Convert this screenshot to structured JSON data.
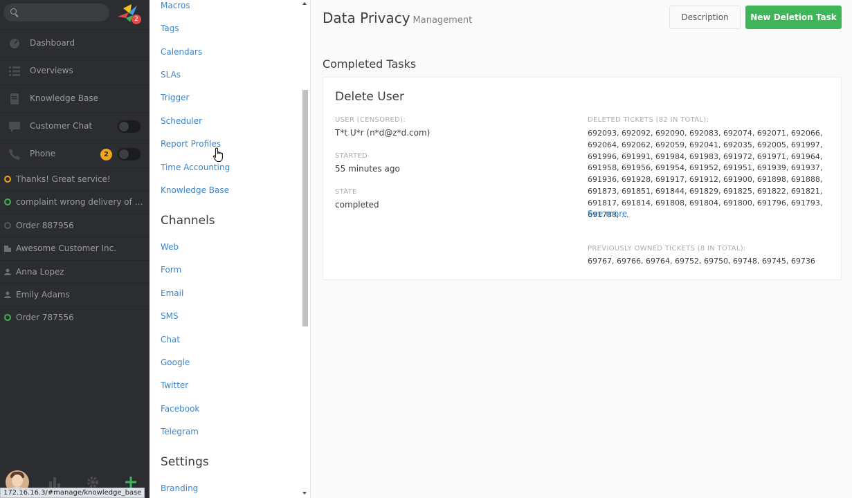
{
  "nav": {
    "notification_count": "2",
    "items": [
      {
        "label": "Dashboard",
        "icon": "dashboard-icon"
      },
      {
        "label": "Overviews",
        "icon": "list-icon"
      },
      {
        "label": "Knowledge Base",
        "icon": "book-icon"
      },
      {
        "label": "Customer Chat",
        "icon": "chat-icon"
      },
      {
        "label": "Phone",
        "icon": "phone-icon"
      }
    ],
    "phone_badge": "2",
    "tasks": [
      {
        "label": "Thanks! Great service!",
        "icon": "ticket-ring-icon",
        "color": "#f0a51a"
      },
      {
        "label": "complaint wrong delivery of order",
        "icon": "ticket-ring-icon",
        "color": "#3fb55a"
      },
      {
        "label": "Order 887956",
        "icon": "ticket-ring-icon",
        "color": "#7b7e82"
      },
      {
        "label": "Awesome Customer Inc.",
        "icon": "organization-icon",
        "color": "#7b7e82"
      },
      {
        "label": "Anna Lopez",
        "icon": "user-icon",
        "color": "#7b7e82"
      },
      {
        "label": "Emily Adams",
        "icon": "user-icon",
        "color": "#7b7e82"
      },
      {
        "label": "Order 787556",
        "icon": "ticket-ring-icon",
        "color": "#3fb55a"
      }
    ],
    "status_url": "172.16.16.3/#manage/knowledge_base"
  },
  "admin": {
    "manage_links": [
      "Macros",
      "Tags",
      "Calendars",
      "SLAs",
      "Trigger",
      "Scheduler",
      "Report Profiles",
      "Time Accounting",
      "Knowledge Base"
    ],
    "channels_heading": "Channels",
    "channel_links": [
      "Web",
      "Form",
      "Email",
      "SMS",
      "Chat",
      "Google",
      "Twitter",
      "Facebook",
      "Telegram"
    ],
    "settings_heading": "Settings",
    "settings_links": [
      "Branding"
    ]
  },
  "page": {
    "title": "Data Privacy",
    "subtitle": "Management",
    "description_button": "Description",
    "new_task_button": "New Deletion Task",
    "section_title": "Completed Tasks"
  },
  "task_card": {
    "title": "Delete User",
    "user_label": "User (censored):",
    "user_value": "T*t U*r (n*d@z*d.com)",
    "started_label": "Started",
    "started_value": "55 minutes ago",
    "state_label": "State",
    "state_value": "completed",
    "deleted_label": "Deleted Tickets (82 in total):",
    "deleted_value": "692093, 692092, 692090, 692083, 692074, 692071, 692066, 692064, 692062, 692059, 692041, 692035, 692005, 691997, 691996, 691991, 691984, 691983, 691972, 691971, 691964, 691958, 691956, 691954, 691952, 691951, 691939, 691937, 691936, 691928, 691917, 691912, 691900, 691898, 691888, 691873, 691851, 691844, 691829, 691825, 691822, 691821, 691817, 691814, 691808, 691804, 691800, 691796, 691793, 691788, ...",
    "see_more": "See more",
    "owned_label": "Previously owned tickets (8 in total):",
    "owned_value": "69767, 69766, 69764, 69752, 69750, 69748, 69745, 69736"
  }
}
